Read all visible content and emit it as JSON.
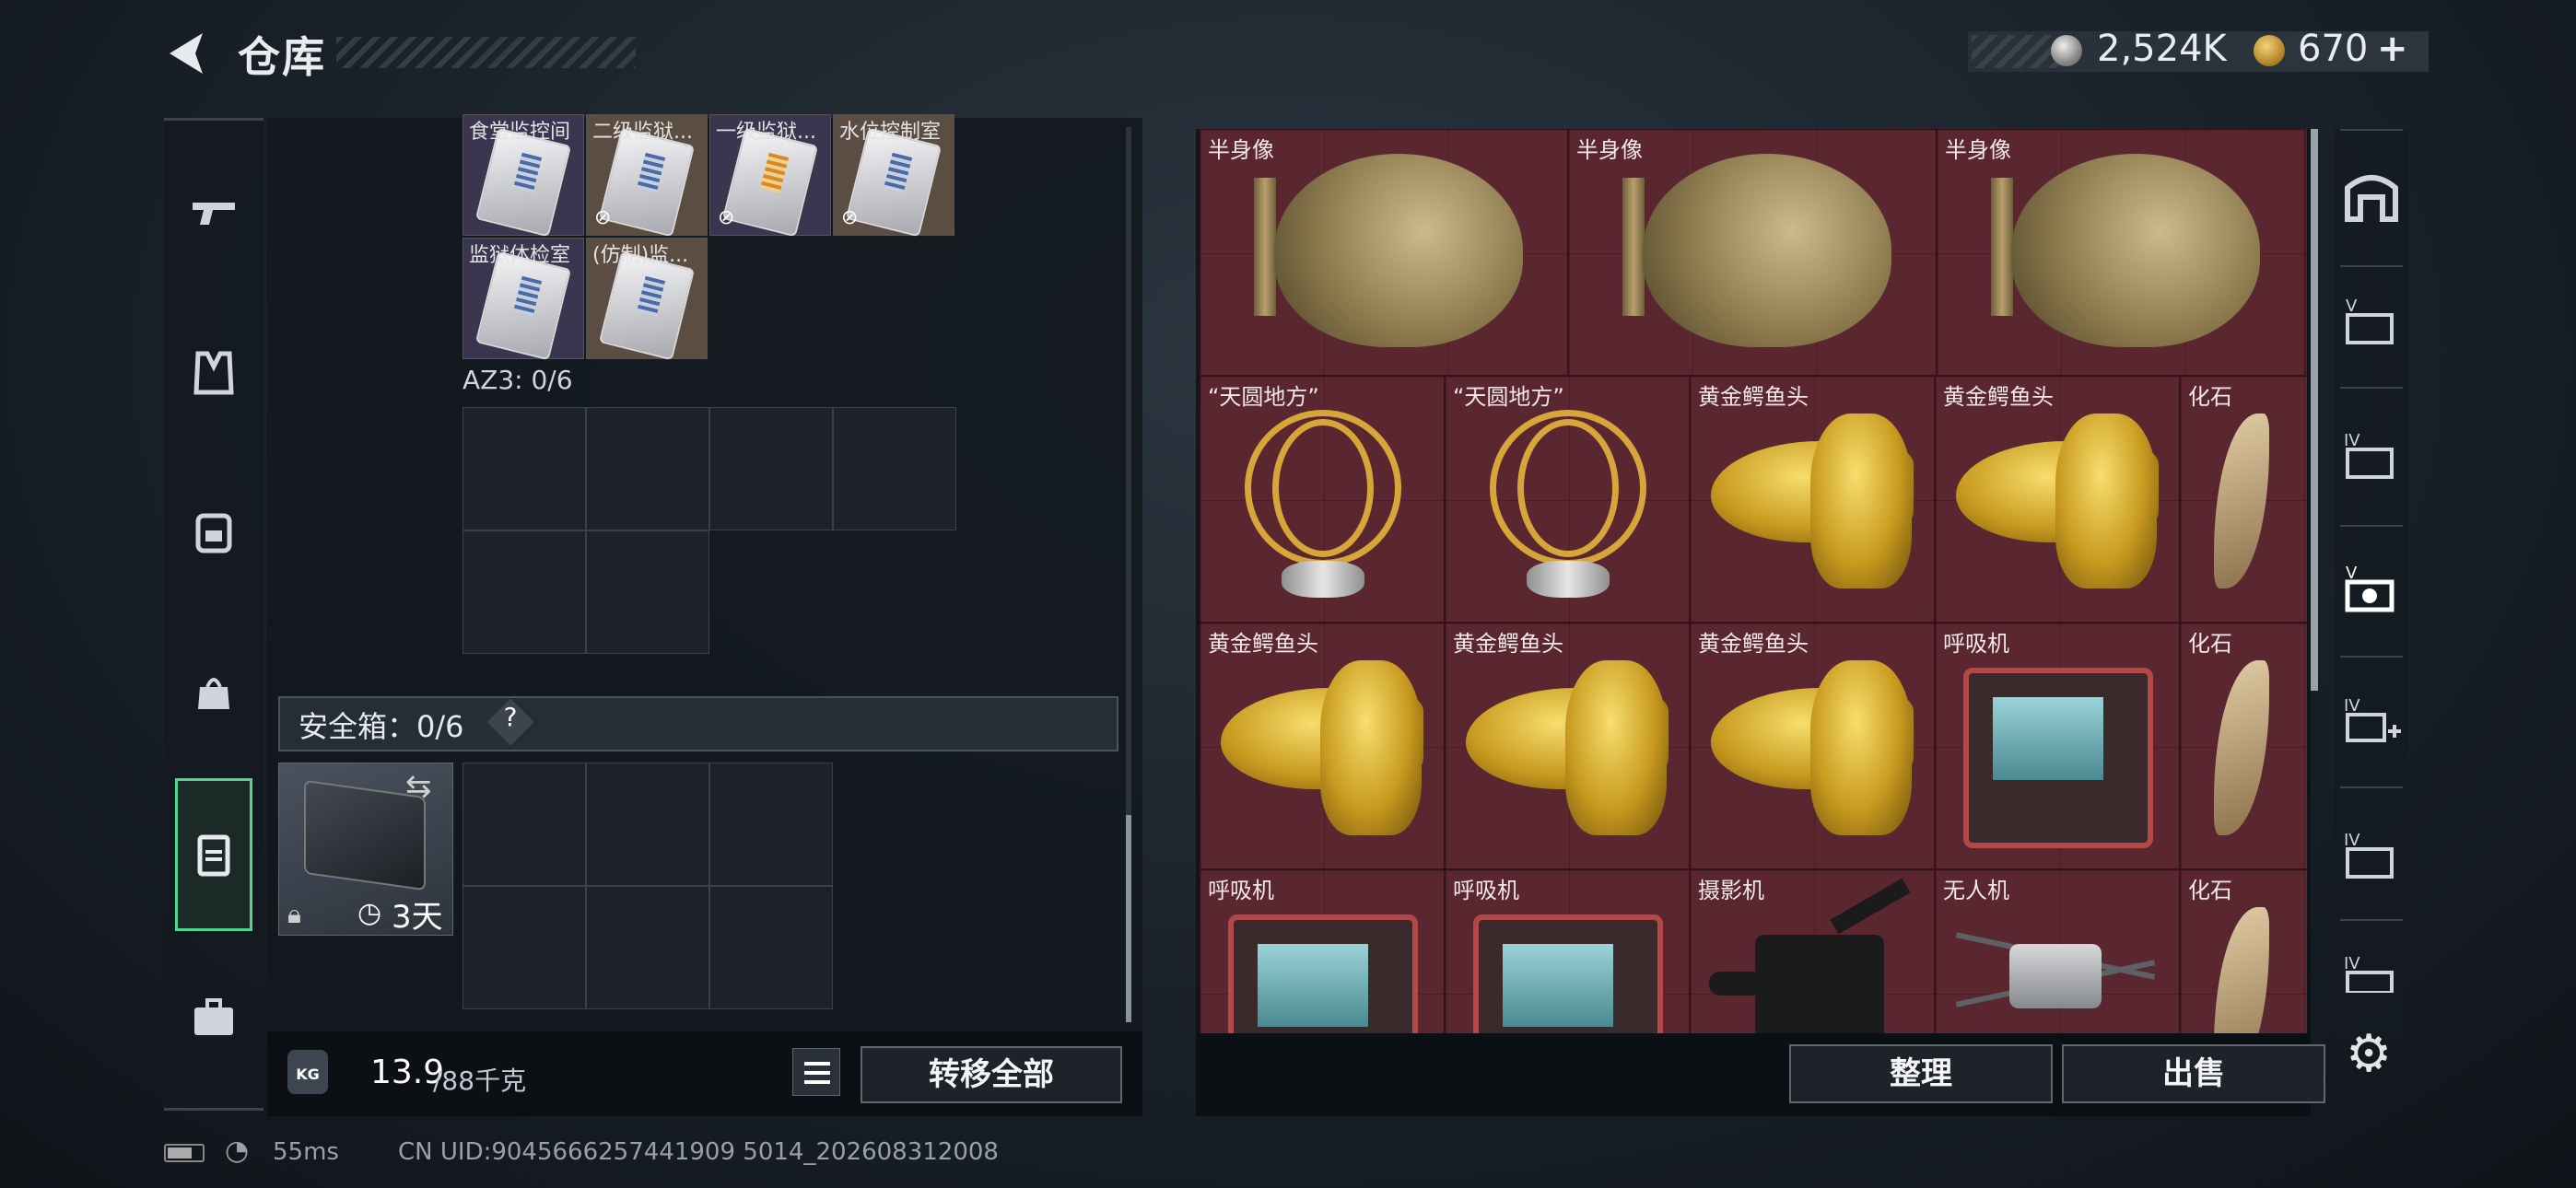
{
  "header": {
    "title": "仓库",
    "silver_amount": "2,524K",
    "gold_amount": "670",
    "gold_add": "+"
  },
  "left_tabs": [
    "gun-icon",
    "vest-icon",
    "backpack-icon",
    "pouch-icon",
    "keycard-case-icon",
    "briefcase-icon"
  ],
  "keycard_cards": [
    {
      "label": "食堂监控间",
      "state": "normal"
    },
    {
      "label": "二级监狱...",
      "state": "disabled"
    },
    {
      "label": "一级监狱...",
      "state": "disabled"
    },
    {
      "label": "水位控制室",
      "state": "disabled"
    },
    {
      "label": "监狱体检室",
      "state": "normal"
    },
    {
      "label": "(仿制)监...",
      "state": "normal"
    }
  ],
  "az3_label": "AZ3: 0/6",
  "safe": {
    "label": "安全箱：0/6",
    "help": "?",
    "days": "3天"
  },
  "weight": {
    "current": "13.9",
    "max": "/88千克",
    "kg": "KG"
  },
  "buttons": {
    "transfer_all": "转移全部",
    "sort": "整理",
    "sell": "出售"
  },
  "items": [
    {
      "label": "半身像",
      "kind": "bust"
    },
    {
      "label": "半身像",
      "kind": "bust"
    },
    {
      "label": "半身像",
      "kind": "bust"
    },
    {
      "label": "“天圆地方”",
      "kind": "globe"
    },
    {
      "label": "“天圆地方”",
      "kind": "globe"
    },
    {
      "label": "黄金鳄鱼头",
      "kind": "croc"
    },
    {
      "label": "黄金鳄鱼头",
      "kind": "croc"
    },
    {
      "label": "化石",
      "kind": "fossil"
    },
    {
      "label": "黄金鳄鱼头",
      "kind": "croc"
    },
    {
      "label": "黄金鳄鱼头",
      "kind": "croc"
    },
    {
      "label": "黄金鳄鱼头",
      "kind": "croc"
    },
    {
      "label": "呼吸机",
      "kind": "vent"
    },
    {
      "label": "化石",
      "kind": "fossil"
    },
    {
      "label": "呼吸机",
      "kind": "vent"
    },
    {
      "label": "呼吸机",
      "kind": "vent"
    },
    {
      "label": "摄影机",
      "kind": "camera"
    },
    {
      "label": "无人机",
      "kind": "drone"
    },
    {
      "label": "化石",
      "kind": "fossil"
    }
  ],
  "right_tabs": [
    "home-icon",
    "v-stash-icon",
    "iv-stash-icon",
    "v-stash-active-icon",
    "iv-add-icon",
    "iv-folder-icon",
    "iv-partial-icon"
  ],
  "status": {
    "ping": "55ms",
    "uid": "CN UID:9045666257441909 5014_202608312008"
  },
  "colors": {
    "accent": "#4cd68f",
    "item_bg": "#5a2630"
  }
}
